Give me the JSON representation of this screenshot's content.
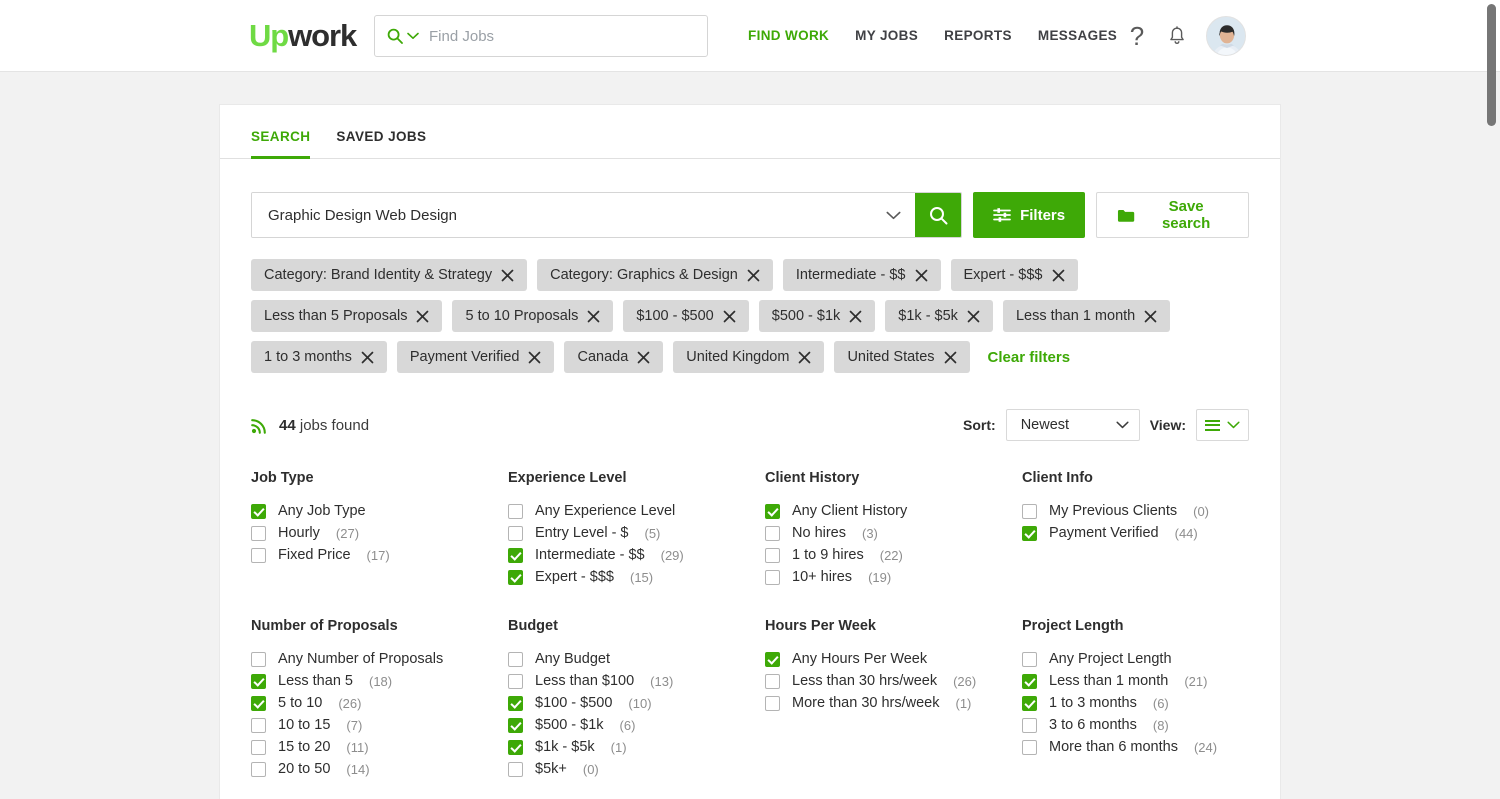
{
  "colors": {
    "brand_green": "#3ea907",
    "logo_green": "#6fda44",
    "chip_bg": "#d8d8d8",
    "page_bg": "#f2f2f2"
  },
  "topnav": {
    "logo": {
      "up": "Up",
      "work": "work"
    },
    "search": {
      "placeholder": "Find Jobs",
      "value": "",
      "icon": "search-icon",
      "caret_icon": "chevron-down-icon"
    },
    "links": [
      {
        "label": "FIND WORK",
        "active": true
      },
      {
        "label": "MY JOBS",
        "active": false
      },
      {
        "label": "REPORTS",
        "active": false
      },
      {
        "label": "MESSAGES",
        "active": false
      }
    ],
    "help_icon": "question-mark-icon",
    "bell_icon": "notification-bell-icon",
    "avatar": "user-avatar"
  },
  "tabs": [
    {
      "label": "SEARCH",
      "active": true
    },
    {
      "label": "SAVED JOBS",
      "active": false
    }
  ],
  "search": {
    "query": "Graphic Design Web Design",
    "caret_icon": "chevron-down-icon",
    "submit_icon": "search-icon",
    "filters_label": "Filters",
    "filters_icon": "sliders-icon",
    "save_label": "Save search",
    "save_icon": "folder-icon"
  },
  "chips": [
    {
      "label": "Category: Brand Identity & Strategy"
    },
    {
      "label": "Category: Graphics & Design"
    },
    {
      "label": "Intermediate - $$"
    },
    {
      "label": "Expert - $$$"
    },
    {
      "label": "Less than 5 Proposals"
    },
    {
      "label": "5 to 10 Proposals"
    },
    {
      "label": "$100 - $500"
    },
    {
      "label": "$500 - $1k"
    },
    {
      "label": "$1k - $5k"
    },
    {
      "label": "Less than 1 month"
    },
    {
      "label": "1 to 3 months"
    },
    {
      "label": "Payment Verified"
    },
    {
      "label": "Canada"
    },
    {
      "label": "United Kingdom"
    },
    {
      "label": "United States"
    }
  ],
  "clear_filters_label": "Clear filters",
  "results": {
    "count": "44",
    "found_label": "jobs found",
    "rss_icon": "rss-feed-icon",
    "sort_label": "Sort:",
    "sort_value": "Newest",
    "view_label": "View:",
    "view_icon": "list-view-icon"
  },
  "facets": [
    {
      "title": "Job Type",
      "options": [
        {
          "label": "Any Job Type",
          "count": "",
          "checked": true
        },
        {
          "label": "Hourly",
          "count": "(27)",
          "checked": false
        },
        {
          "label": "Fixed Price",
          "count": "(17)",
          "checked": false
        }
      ]
    },
    {
      "title": "Experience Level",
      "options": [
        {
          "label": "Any Experience Level",
          "count": "",
          "checked": false
        },
        {
          "label": "Entry Level - $",
          "count": "(5)",
          "checked": false
        },
        {
          "label": "Intermediate - $$",
          "count": "(29)",
          "checked": true
        },
        {
          "label": "Expert - $$$",
          "count": "(15)",
          "checked": true
        }
      ]
    },
    {
      "title": "Client History",
      "options": [
        {
          "label": "Any Client History",
          "count": "",
          "checked": true
        },
        {
          "label": "No hires",
          "count": "(3)",
          "checked": false
        },
        {
          "label": "1 to 9 hires",
          "count": "(22)",
          "checked": false
        },
        {
          "label": "10+ hires",
          "count": "(19)",
          "checked": false
        }
      ]
    },
    {
      "title": "Client Info",
      "options": [
        {
          "label": "My Previous Clients",
          "count": "(0)",
          "checked": false
        },
        {
          "label": "Payment Verified",
          "count": "(44)",
          "checked": true
        }
      ]
    },
    {
      "title": "Number of Proposals",
      "options": [
        {
          "label": "Any Number of Proposals",
          "count": "",
          "checked": false
        },
        {
          "label": "Less than 5",
          "count": "(18)",
          "checked": true
        },
        {
          "label": "5 to 10",
          "count": "(26)",
          "checked": true
        },
        {
          "label": "10 to 15",
          "count": "(7)",
          "checked": false
        },
        {
          "label": "15 to 20",
          "count": "(11)",
          "checked": false
        },
        {
          "label": "20 to 50",
          "count": "(14)",
          "checked": false
        }
      ]
    },
    {
      "title": "Budget",
      "options": [
        {
          "label": "Any Budget",
          "count": "",
          "checked": false
        },
        {
          "label": "Less than $100",
          "count": "(13)",
          "checked": false
        },
        {
          "label": "$100 - $500",
          "count": "(10)",
          "checked": true
        },
        {
          "label": "$500 - $1k",
          "count": "(6)",
          "checked": true
        },
        {
          "label": "$1k - $5k",
          "count": "(1)",
          "checked": true
        },
        {
          "label": "$5k+",
          "count": "(0)",
          "checked": false
        }
      ]
    },
    {
      "title": "Hours Per Week",
      "options": [
        {
          "label": "Any Hours Per Week",
          "count": "",
          "checked": true
        },
        {
          "label": "Less than 30 hrs/week",
          "count": "(26)",
          "checked": false
        },
        {
          "label": "More than 30 hrs/week",
          "count": "(1)",
          "checked": false
        }
      ]
    },
    {
      "title": "Project Length",
      "options": [
        {
          "label": "Any Project Length",
          "count": "",
          "checked": false
        },
        {
          "label": "Less than 1 month",
          "count": "(21)",
          "checked": true
        },
        {
          "label": "1 to 3 months",
          "count": "(6)",
          "checked": true
        },
        {
          "label": "3 to 6 months",
          "count": "(8)",
          "checked": false
        },
        {
          "label": "More than 6 months",
          "count": "(24)",
          "checked": false
        }
      ]
    }
  ]
}
